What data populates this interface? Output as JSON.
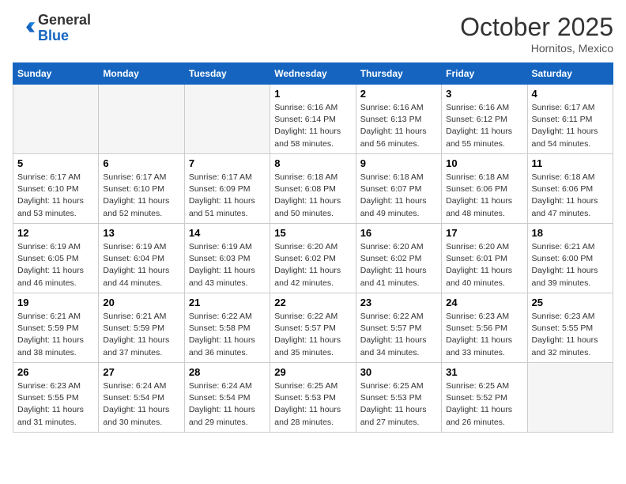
{
  "header": {
    "logo_general": "General",
    "logo_blue": "Blue",
    "month_title": "October 2025",
    "subtitle": "Hornitos, Mexico"
  },
  "days_of_week": [
    "Sunday",
    "Monday",
    "Tuesday",
    "Wednesday",
    "Thursday",
    "Friday",
    "Saturday"
  ],
  "weeks": [
    [
      {
        "day": "",
        "empty": true
      },
      {
        "day": "",
        "empty": true
      },
      {
        "day": "",
        "empty": true
      },
      {
        "day": "1",
        "sunrise": "6:16 AM",
        "sunset": "6:14 PM",
        "daylight": "11 hours and 58 minutes."
      },
      {
        "day": "2",
        "sunrise": "6:16 AM",
        "sunset": "6:13 PM",
        "daylight": "11 hours and 56 minutes."
      },
      {
        "day": "3",
        "sunrise": "6:16 AM",
        "sunset": "6:12 PM",
        "daylight": "11 hours and 55 minutes."
      },
      {
        "day": "4",
        "sunrise": "6:17 AM",
        "sunset": "6:11 PM",
        "daylight": "11 hours and 54 minutes."
      }
    ],
    [
      {
        "day": "5",
        "sunrise": "6:17 AM",
        "sunset": "6:10 PM",
        "daylight": "11 hours and 53 minutes."
      },
      {
        "day": "6",
        "sunrise": "6:17 AM",
        "sunset": "6:10 PM",
        "daylight": "11 hours and 52 minutes."
      },
      {
        "day": "7",
        "sunrise": "6:17 AM",
        "sunset": "6:09 PM",
        "daylight": "11 hours and 51 minutes."
      },
      {
        "day": "8",
        "sunrise": "6:18 AM",
        "sunset": "6:08 PM",
        "daylight": "11 hours and 50 minutes."
      },
      {
        "day": "9",
        "sunrise": "6:18 AM",
        "sunset": "6:07 PM",
        "daylight": "11 hours and 49 minutes."
      },
      {
        "day": "10",
        "sunrise": "6:18 AM",
        "sunset": "6:06 PM",
        "daylight": "11 hours and 48 minutes."
      },
      {
        "day": "11",
        "sunrise": "6:18 AM",
        "sunset": "6:06 PM",
        "daylight": "11 hours and 47 minutes."
      }
    ],
    [
      {
        "day": "12",
        "sunrise": "6:19 AM",
        "sunset": "6:05 PM",
        "daylight": "11 hours and 46 minutes."
      },
      {
        "day": "13",
        "sunrise": "6:19 AM",
        "sunset": "6:04 PM",
        "daylight": "11 hours and 44 minutes."
      },
      {
        "day": "14",
        "sunrise": "6:19 AM",
        "sunset": "6:03 PM",
        "daylight": "11 hours and 43 minutes."
      },
      {
        "day": "15",
        "sunrise": "6:20 AM",
        "sunset": "6:02 PM",
        "daylight": "11 hours and 42 minutes."
      },
      {
        "day": "16",
        "sunrise": "6:20 AM",
        "sunset": "6:02 PM",
        "daylight": "11 hours and 41 minutes."
      },
      {
        "day": "17",
        "sunrise": "6:20 AM",
        "sunset": "6:01 PM",
        "daylight": "11 hours and 40 minutes."
      },
      {
        "day": "18",
        "sunrise": "6:21 AM",
        "sunset": "6:00 PM",
        "daylight": "11 hours and 39 minutes."
      }
    ],
    [
      {
        "day": "19",
        "sunrise": "6:21 AM",
        "sunset": "5:59 PM",
        "daylight": "11 hours and 38 minutes."
      },
      {
        "day": "20",
        "sunrise": "6:21 AM",
        "sunset": "5:59 PM",
        "daylight": "11 hours and 37 minutes."
      },
      {
        "day": "21",
        "sunrise": "6:22 AM",
        "sunset": "5:58 PM",
        "daylight": "11 hours and 36 minutes."
      },
      {
        "day": "22",
        "sunrise": "6:22 AM",
        "sunset": "5:57 PM",
        "daylight": "11 hours and 35 minutes."
      },
      {
        "day": "23",
        "sunrise": "6:22 AM",
        "sunset": "5:57 PM",
        "daylight": "11 hours and 34 minutes."
      },
      {
        "day": "24",
        "sunrise": "6:23 AM",
        "sunset": "5:56 PM",
        "daylight": "11 hours and 33 minutes."
      },
      {
        "day": "25",
        "sunrise": "6:23 AM",
        "sunset": "5:55 PM",
        "daylight": "11 hours and 32 minutes."
      }
    ],
    [
      {
        "day": "26",
        "sunrise": "6:23 AM",
        "sunset": "5:55 PM",
        "daylight": "11 hours and 31 minutes."
      },
      {
        "day": "27",
        "sunrise": "6:24 AM",
        "sunset": "5:54 PM",
        "daylight": "11 hours and 30 minutes."
      },
      {
        "day": "28",
        "sunrise": "6:24 AM",
        "sunset": "5:54 PM",
        "daylight": "11 hours and 29 minutes."
      },
      {
        "day": "29",
        "sunrise": "6:25 AM",
        "sunset": "5:53 PM",
        "daylight": "11 hours and 28 minutes."
      },
      {
        "day": "30",
        "sunrise": "6:25 AM",
        "sunset": "5:53 PM",
        "daylight": "11 hours and 27 minutes."
      },
      {
        "day": "31",
        "sunrise": "6:25 AM",
        "sunset": "5:52 PM",
        "daylight": "11 hours and 26 minutes."
      },
      {
        "day": "",
        "empty": true
      }
    ]
  ]
}
